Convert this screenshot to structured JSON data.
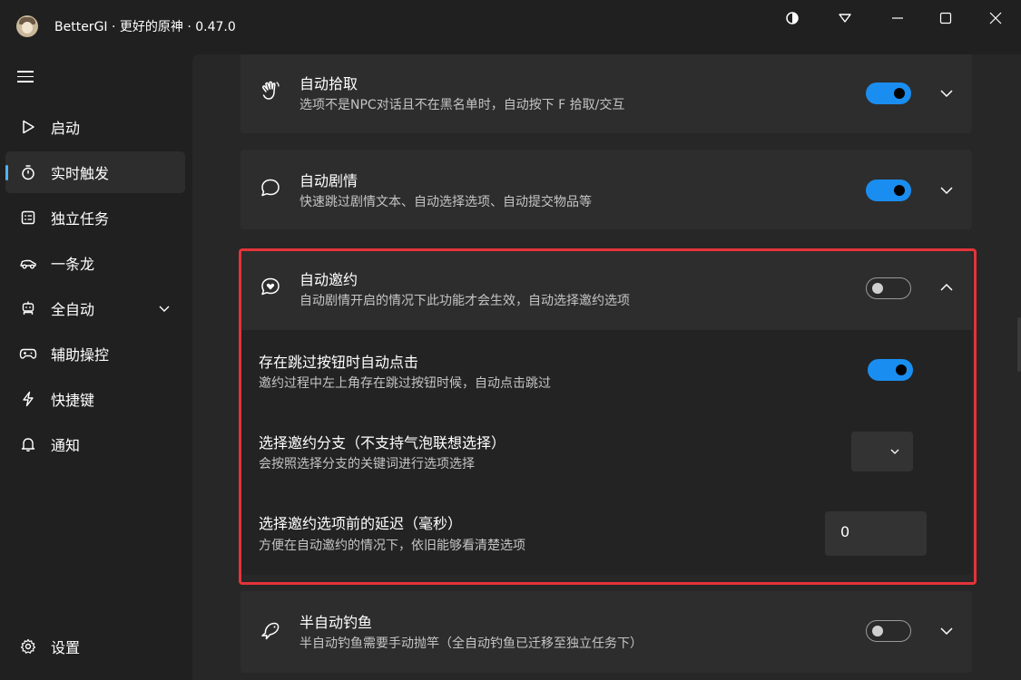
{
  "window": {
    "title": "BetterGI · 更好的原神 · 0.47.0",
    "controls": [
      "theme-icon",
      "dropdown-icon",
      "minimize-icon",
      "maximize-icon",
      "close-icon"
    ]
  },
  "sidebar": {
    "items": [
      {
        "label": "启动",
        "icon": "play-icon"
      },
      {
        "label": "实时触发",
        "icon": "timer-icon",
        "active": true
      },
      {
        "label": "独立任务",
        "icon": "task-list-icon"
      },
      {
        "label": "一条龙",
        "icon": "vehicle-icon"
      },
      {
        "label": "全自动",
        "icon": "robot-icon",
        "expandable": true
      },
      {
        "label": "辅助操控",
        "icon": "gamepad-icon"
      },
      {
        "label": "快捷键",
        "icon": "flash-icon"
      },
      {
        "label": "通知",
        "icon": "bell-icon"
      }
    ],
    "settings_label": "设置"
  },
  "cards": {
    "pickup": {
      "title": "自动拾取",
      "desc": "选项不是NPC对话且不在黑名单时，自动按下 F 拾取/交互",
      "enabled": true
    },
    "story": {
      "title": "自动剧情",
      "desc": "快速跳过剧情文本、自动选择选项、自动提交物品等",
      "enabled": true
    },
    "invite": {
      "title": "自动邀约",
      "desc": "自动剧情开启的情况下此功能才会生效，自动选择邀约选项",
      "enabled": false,
      "expanded": true,
      "settings": {
        "skip": {
          "title": "存在跳过按钮时自动点击",
          "desc": "邀约过程中左上角存在跳过按钮时候，自动点击跳过",
          "enabled": true
        },
        "branch": {
          "title": "选择邀约分支（不支持气泡联想选择）",
          "desc": "会按照选择分支的关键词进行选项选择",
          "value": ""
        },
        "delay": {
          "title": "选择邀约选项前的延迟（毫秒）",
          "desc": "方便在自动邀约的情况下，依旧能够看清楚选项",
          "value": "0"
        }
      }
    },
    "fishing": {
      "title": "半自动钓鱼",
      "desc": "半自动钓鱼需要手动抛竿（全自动钓鱼已迁移至独立任务下）",
      "enabled": false
    }
  },
  "colors": {
    "accent": "#1a8ef0",
    "highlight": "#e5333a",
    "indicator": "#4fb3ff"
  }
}
